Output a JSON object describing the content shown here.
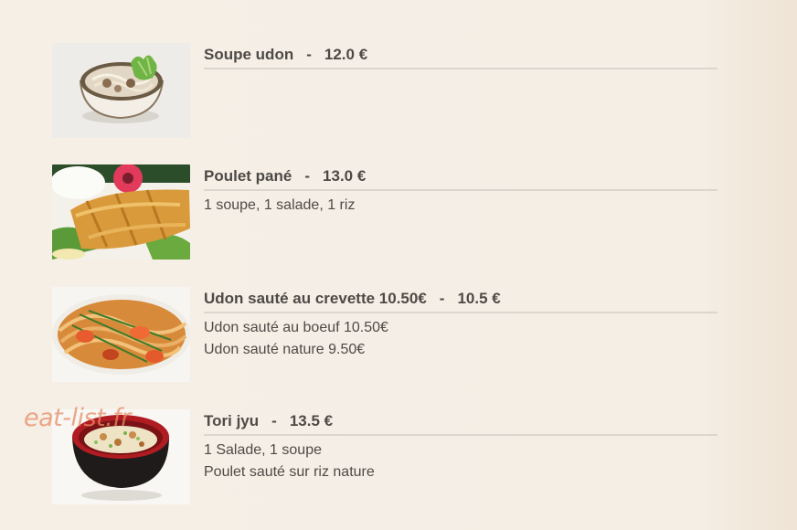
{
  "menu": {
    "items": [
      {
        "name": "Soupe udon",
        "sep": "-",
        "price": "12.0 €",
        "desc": []
      },
      {
        "name": "Poulet pané",
        "sep": "-",
        "price": "13.0 €",
        "desc": [
          "1 soupe, 1 salade, 1 riz"
        ]
      },
      {
        "name": "Udon sauté au crevette 10.50€",
        "sep": "-",
        "price": "10.5 €",
        "desc": [
          "Udon sauté au boeuf 10.50€",
          "Udon sauté nature 9.50€"
        ]
      },
      {
        "name": "Tori jyu",
        "sep": "-",
        "price": "13.5 €",
        "desc": [
          "1 Salade, 1 soupe",
          "Poulet sauté sur riz nature"
        ]
      }
    ]
  },
  "watermark": "eat-list.fr",
  "colors": {
    "text": "#4d4a46",
    "divider": "#dcd6cf",
    "watermark": "#e78c64",
    "background": "#f5efe6"
  }
}
